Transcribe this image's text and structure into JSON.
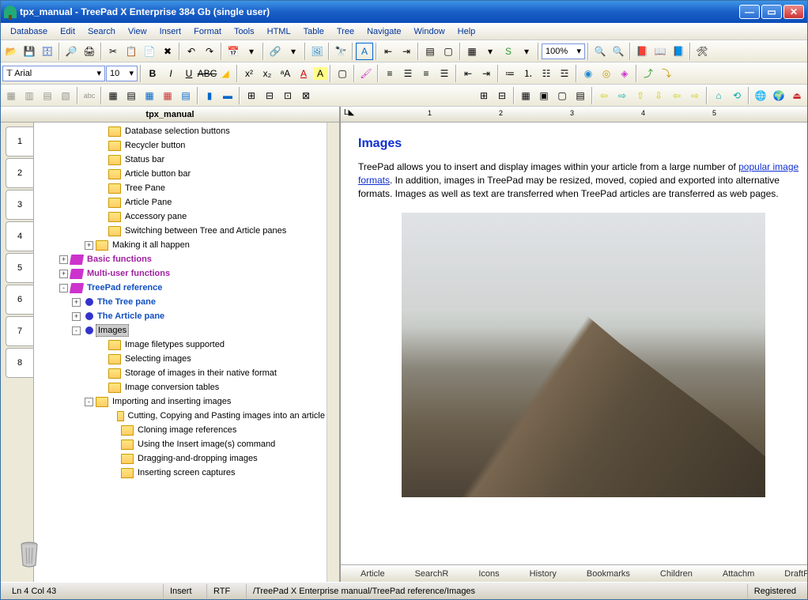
{
  "window": {
    "title": "tpx_manual - TreePad X Enterprise 384 Gb (single user)"
  },
  "menu": [
    "Database",
    "Edit",
    "Search",
    "View",
    "Insert",
    "Format",
    "Tools",
    "HTML",
    "Table",
    "Tree",
    "Navigate",
    "Window",
    "Help"
  ],
  "font": {
    "name": "Arial",
    "size": "10"
  },
  "zoom": "100%",
  "tree_title": "tpx_manual",
  "vtabs": [
    "1",
    "2",
    "3",
    "4",
    "5",
    "6",
    "7",
    "8"
  ],
  "tree": [
    {
      "indent": 5,
      "icon": "folder",
      "label": "Database selection buttons"
    },
    {
      "indent": 5,
      "icon": "folder",
      "label": "Recycler button"
    },
    {
      "indent": 5,
      "icon": "folder",
      "label": "Status bar"
    },
    {
      "indent": 5,
      "icon": "folder",
      "label": "Article button bar"
    },
    {
      "indent": 5,
      "icon": "folder",
      "label": "Tree Pane"
    },
    {
      "indent": 5,
      "icon": "folder",
      "label": "Article Pane"
    },
    {
      "indent": 5,
      "icon": "folder",
      "label": "Accessory pane"
    },
    {
      "indent": 5,
      "icon": "folder",
      "label": "Switching between Tree and Article panes"
    },
    {
      "indent": 4,
      "exp": "+",
      "icon": "folder",
      "label": "Making it all happen"
    },
    {
      "indent": 2,
      "exp": "+",
      "icon": "book",
      "label": "Basic functions",
      "cls": "purple"
    },
    {
      "indent": 2,
      "exp": "+",
      "icon": "book",
      "label": "Multi-user functions",
      "cls": "purple"
    },
    {
      "indent": 2,
      "exp": "-",
      "icon": "book",
      "label": "TreePad reference",
      "cls": "blue"
    },
    {
      "indent": 3,
      "exp": "+",
      "icon": "dot",
      "label": "The Tree pane",
      "cls": "blue"
    },
    {
      "indent": 3,
      "exp": "+",
      "icon": "dot",
      "label": "The Article pane",
      "cls": "blue"
    },
    {
      "indent": 3,
      "exp": "-",
      "icon": "dot",
      "label": "Images",
      "sel": true
    },
    {
      "indent": 5,
      "icon": "folder",
      "label": "Image filetypes supported"
    },
    {
      "indent": 5,
      "icon": "folder",
      "label": "Selecting images"
    },
    {
      "indent": 5,
      "icon": "folder",
      "label": "Storage of images in their native format"
    },
    {
      "indent": 5,
      "icon": "folder",
      "label": "Image conversion tables"
    },
    {
      "indent": 4,
      "exp": "-",
      "icon": "folder",
      "label": "Importing and inserting images"
    },
    {
      "indent": 6,
      "icon": "folder",
      "label": "Cutting, Copying and Pasting images into an article"
    },
    {
      "indent": 6,
      "icon": "folder",
      "label": "Cloning image references"
    },
    {
      "indent": 6,
      "icon": "folder",
      "label": "Using the Insert image(s) command"
    },
    {
      "indent": 6,
      "icon": "folder",
      "label": "Dragging-and-dropping images"
    },
    {
      "indent": 6,
      "icon": "folder",
      "label": "Inserting screen captures"
    }
  ],
  "article": {
    "heading": "Images",
    "text1": "TreePad allows you to insert and display images within your article from a large number of ",
    "link": "popular image formats",
    "text2": ". In addition, images in TreePad may be resized, moved, copied and exported into alternative formats. Images as well as text are transferred when TreePad articles are transferred as web pages."
  },
  "bottom_tabs": [
    "Article",
    "SearchR",
    "Icons",
    "History",
    "Bookmarks",
    "Children",
    "Attachm",
    "DraftPad"
  ],
  "status": {
    "pos": "Ln 4  Col 43",
    "mode": "Insert",
    "fmt": "RTF",
    "path": "/TreePad X Enterprise manual/TreePad reference/Images",
    "reg": "Registered"
  },
  "ruler_ticks": [
    "1",
    "2",
    "3",
    "4",
    "5"
  ]
}
